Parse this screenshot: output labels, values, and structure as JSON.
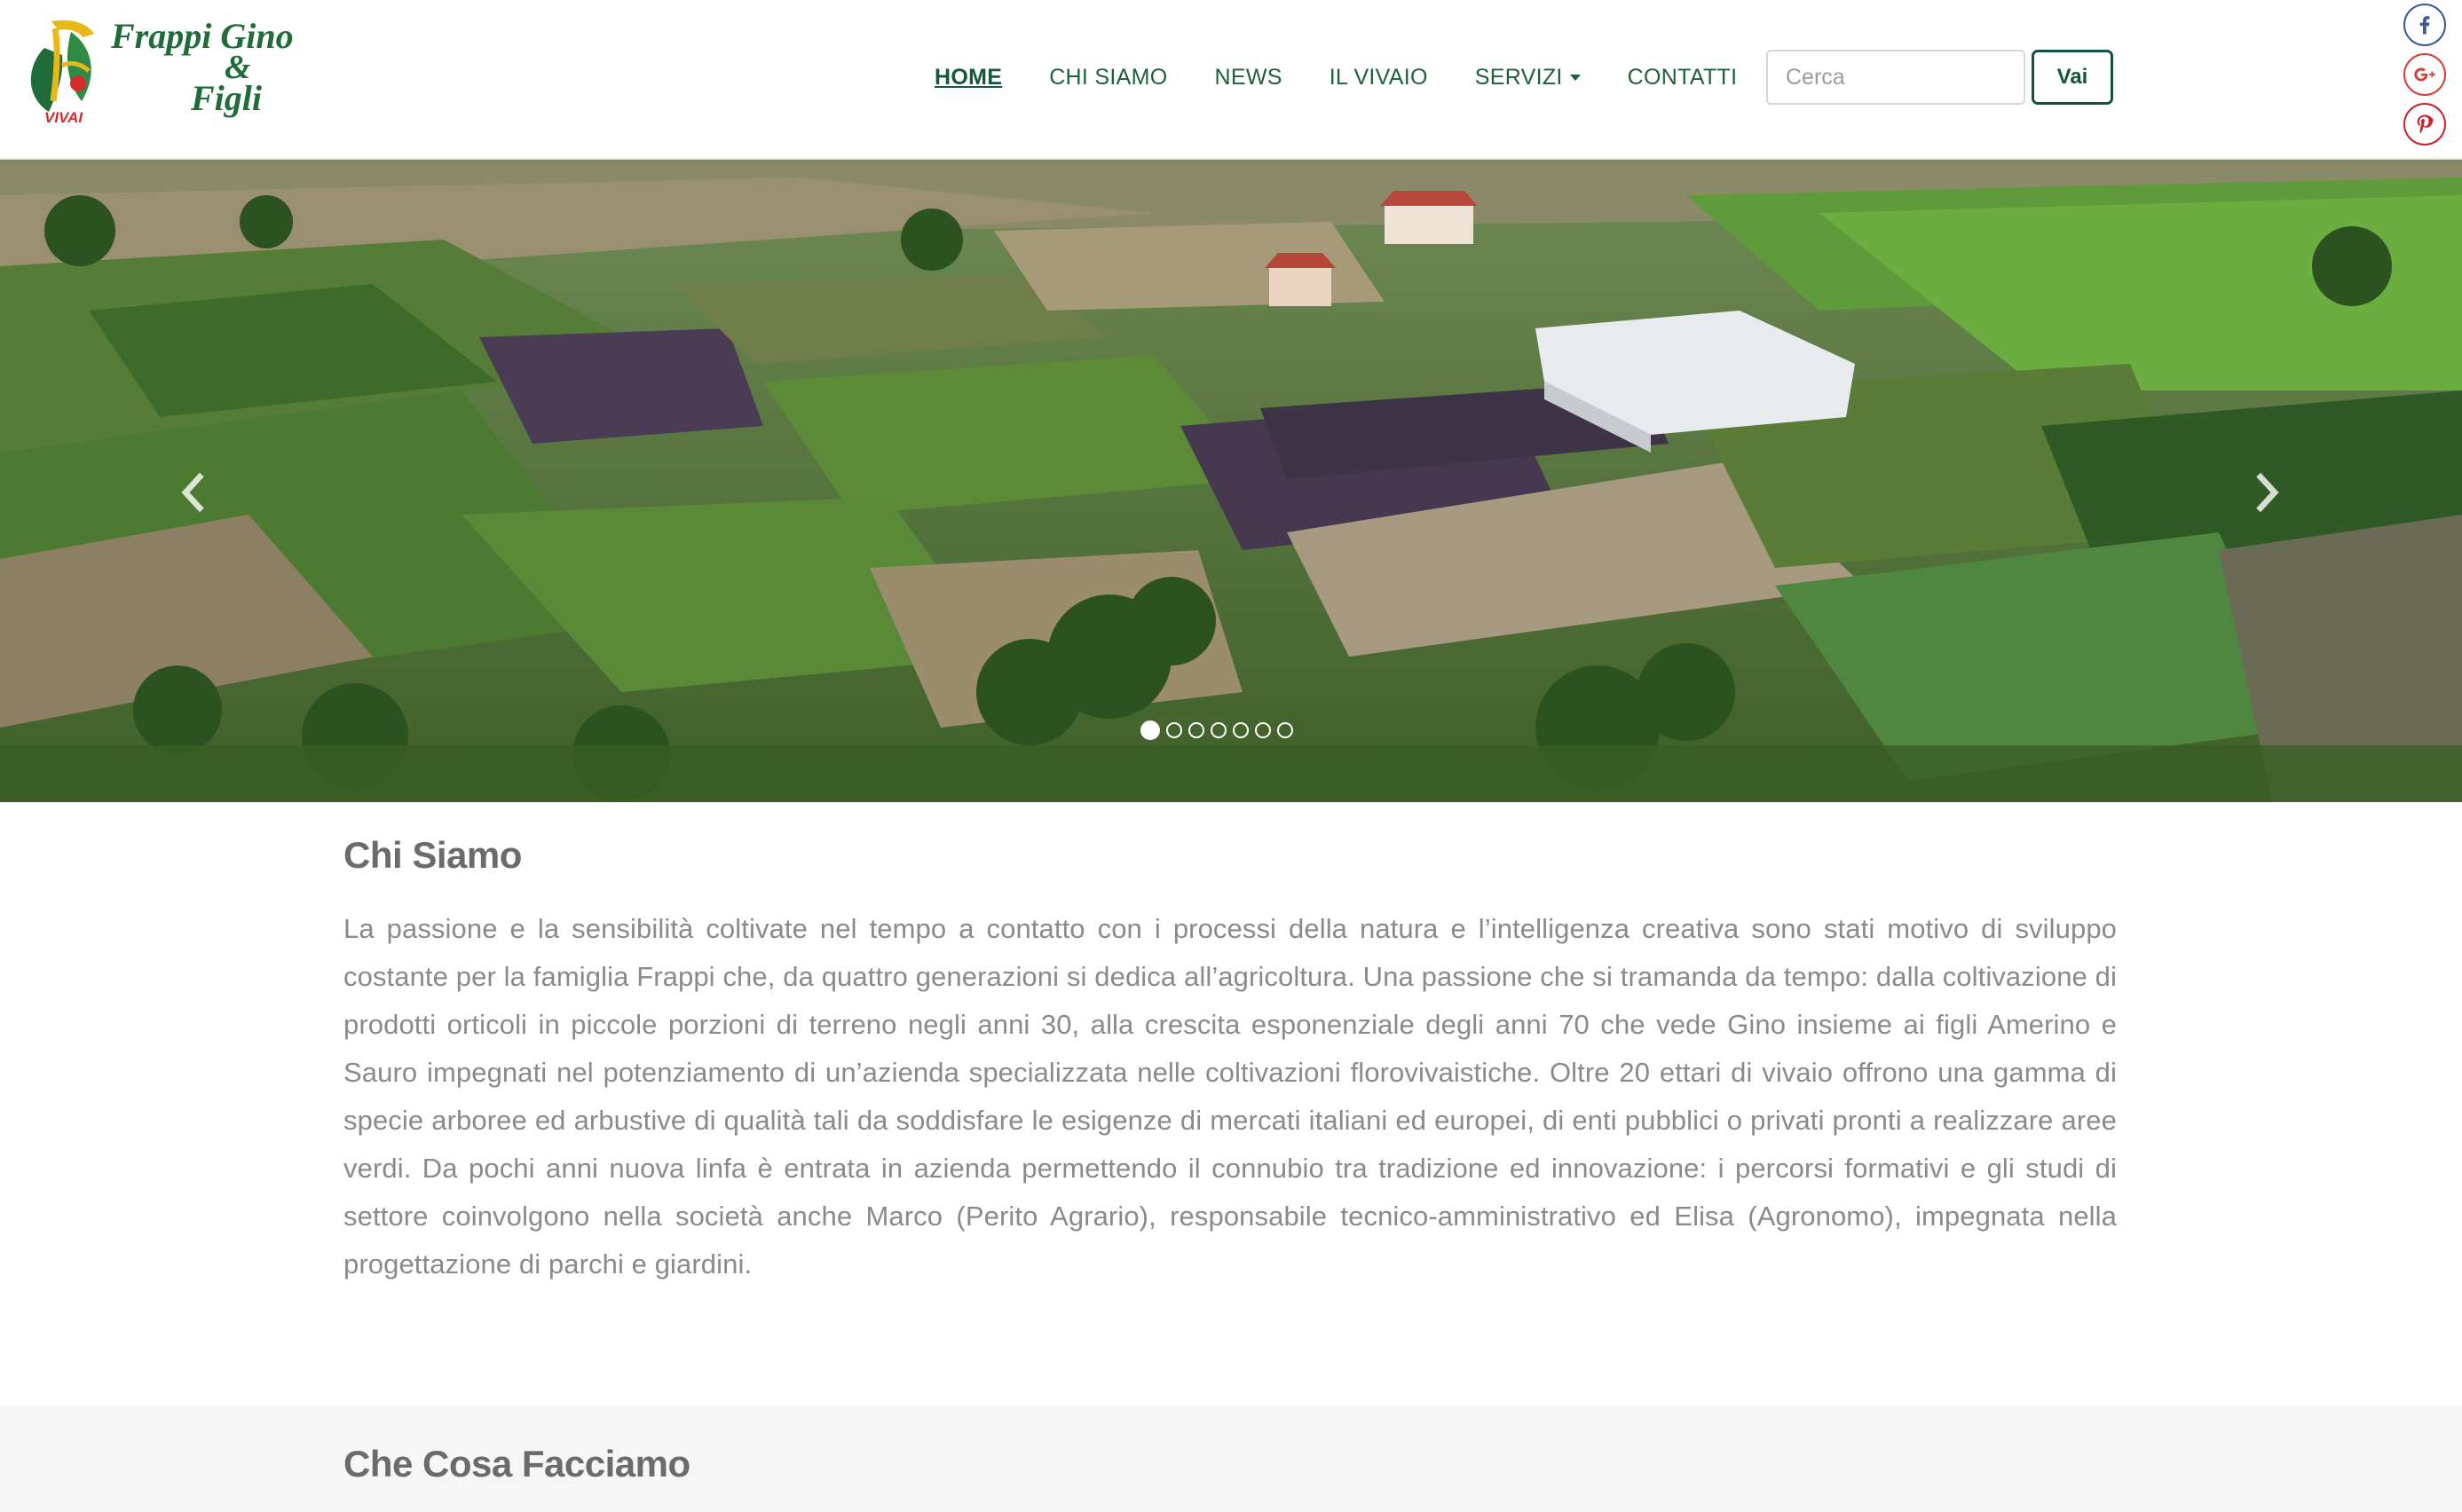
{
  "brand": {
    "name_line1": "Frappi Gino",
    "name_line2": "&",
    "name_line3": "Figli",
    "logo_tag": "VIVAI",
    "primary_color": "#1f6b3a",
    "accent_color": "#d52b2b",
    "logo_mark_color": "#e8b71a"
  },
  "nav": {
    "items": [
      {
        "label": "HOME",
        "active": true
      },
      {
        "label": "CHI SIAMO",
        "active": false
      },
      {
        "label": "NEWS",
        "active": false
      },
      {
        "label": "IL VIVAIO",
        "active": false
      },
      {
        "label": "SERVIZI",
        "active": false,
        "has_dropdown": true
      },
      {
        "label": "CONTATTI",
        "active": false
      }
    ]
  },
  "search": {
    "placeholder": "Cerca",
    "value": "",
    "button_label": "Vai"
  },
  "social": [
    {
      "icon": "facebook-icon",
      "color": "#3b5998"
    },
    {
      "icon": "google-plus-icon",
      "color": "#d73d32"
    },
    {
      "icon": "pinterest-icon",
      "color": "#cb2027"
    }
  ],
  "slider": {
    "slide_count": 7,
    "active_index": 0,
    "prev_icon": "chevron-left-icon",
    "next_icon": "chevron-right-icon"
  },
  "about": {
    "title": "Chi Siamo",
    "text": "La passione e la sensibilità coltivate nel tempo a contatto con i processi della natura e l’intelligenza creativa sono stati motivo di sviluppo costante per la famiglia Frappi che, da quattro generazioni si dedica all’agricoltura. Una passione che si tramanda da tempo: dalla coltivazione di prodotti orticoli in piccole porzioni di terreno negli anni 30, alla crescita esponenziale degli anni 70 che vede Gino insieme ai figli Amerino e Sauro impegnati nel potenziamento di un’azienda specializzata nelle coltivazioni florovivaistiche. Oltre 20 ettari di vivaio offrono una gamma di specie arboree ed arbustive di qualità tali da soddisfare le esigenze di mercati italiani ed europei, di enti pubblici o privati pronti a realizzare aree verdi. Da pochi anni nuova linfa è entrata in azienda permettendo il connubio tra tradizione ed innovazione: i percorsi formativi e gli studi di settore coinvolgono nella società anche Marco (Perito Agrario), responsabile tecnico-amministrativo ed Elisa (Agronomo), impegnata nella progettazione di parchi e giardini."
  },
  "services": {
    "title": "Che Cosa Facciamo"
  }
}
